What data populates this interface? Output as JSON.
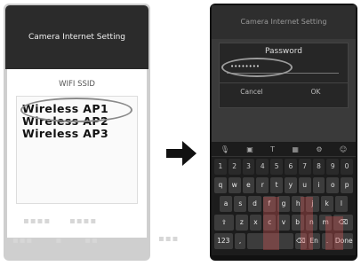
{
  "left_screen": {
    "header_title": "Camera Internet Setting",
    "ssid_label": "WIFI SSID",
    "ssid_items": [
      "Wireless  AP1",
      "Wireless  AP2",
      "Wireless  AP3"
    ],
    "highlighted_item": "Wireless  AP1"
  },
  "arrow": {
    "icon": "right-arrow-icon"
  },
  "right_screen": {
    "header_title": "Camera Internet Setting",
    "dialog": {
      "title": "Password",
      "password_value": "••••••••",
      "cancel_label": "Cancel",
      "ok_label": "OK"
    },
    "keyboard": {
      "toolbar_icons": [
        "mic-icon",
        "clipboard-icon",
        "text-icon",
        "keyboard-icon",
        "gear-icon",
        "emoji-icon"
      ],
      "row_numbers": [
        "1",
        "2",
        "3",
        "4",
        "5",
        "6",
        "7",
        "8",
        "9",
        "0"
      ],
      "row_1": [
        "q",
        "w",
        "e",
        "r",
        "t",
        "y",
        "u",
        "i",
        "o",
        "p"
      ],
      "row_2": [
        "a",
        "s",
        "d",
        "f",
        "g",
        "h",
        "j",
        "k",
        "l"
      ],
      "row_3": [
        "⇧",
        "z",
        "x",
        "c",
        "v",
        "b",
        "n",
        "m",
        "⌫"
      ],
      "row_4": [
        "123",
        ",",
        "",
        "⌫",
        "En",
        ".",
        "Done"
      ]
    }
  },
  "colors": {
    "left_header_bg": "#2b2b2b",
    "right_bg": "#111111",
    "highlight_ring": "#8a8a8a"
  }
}
